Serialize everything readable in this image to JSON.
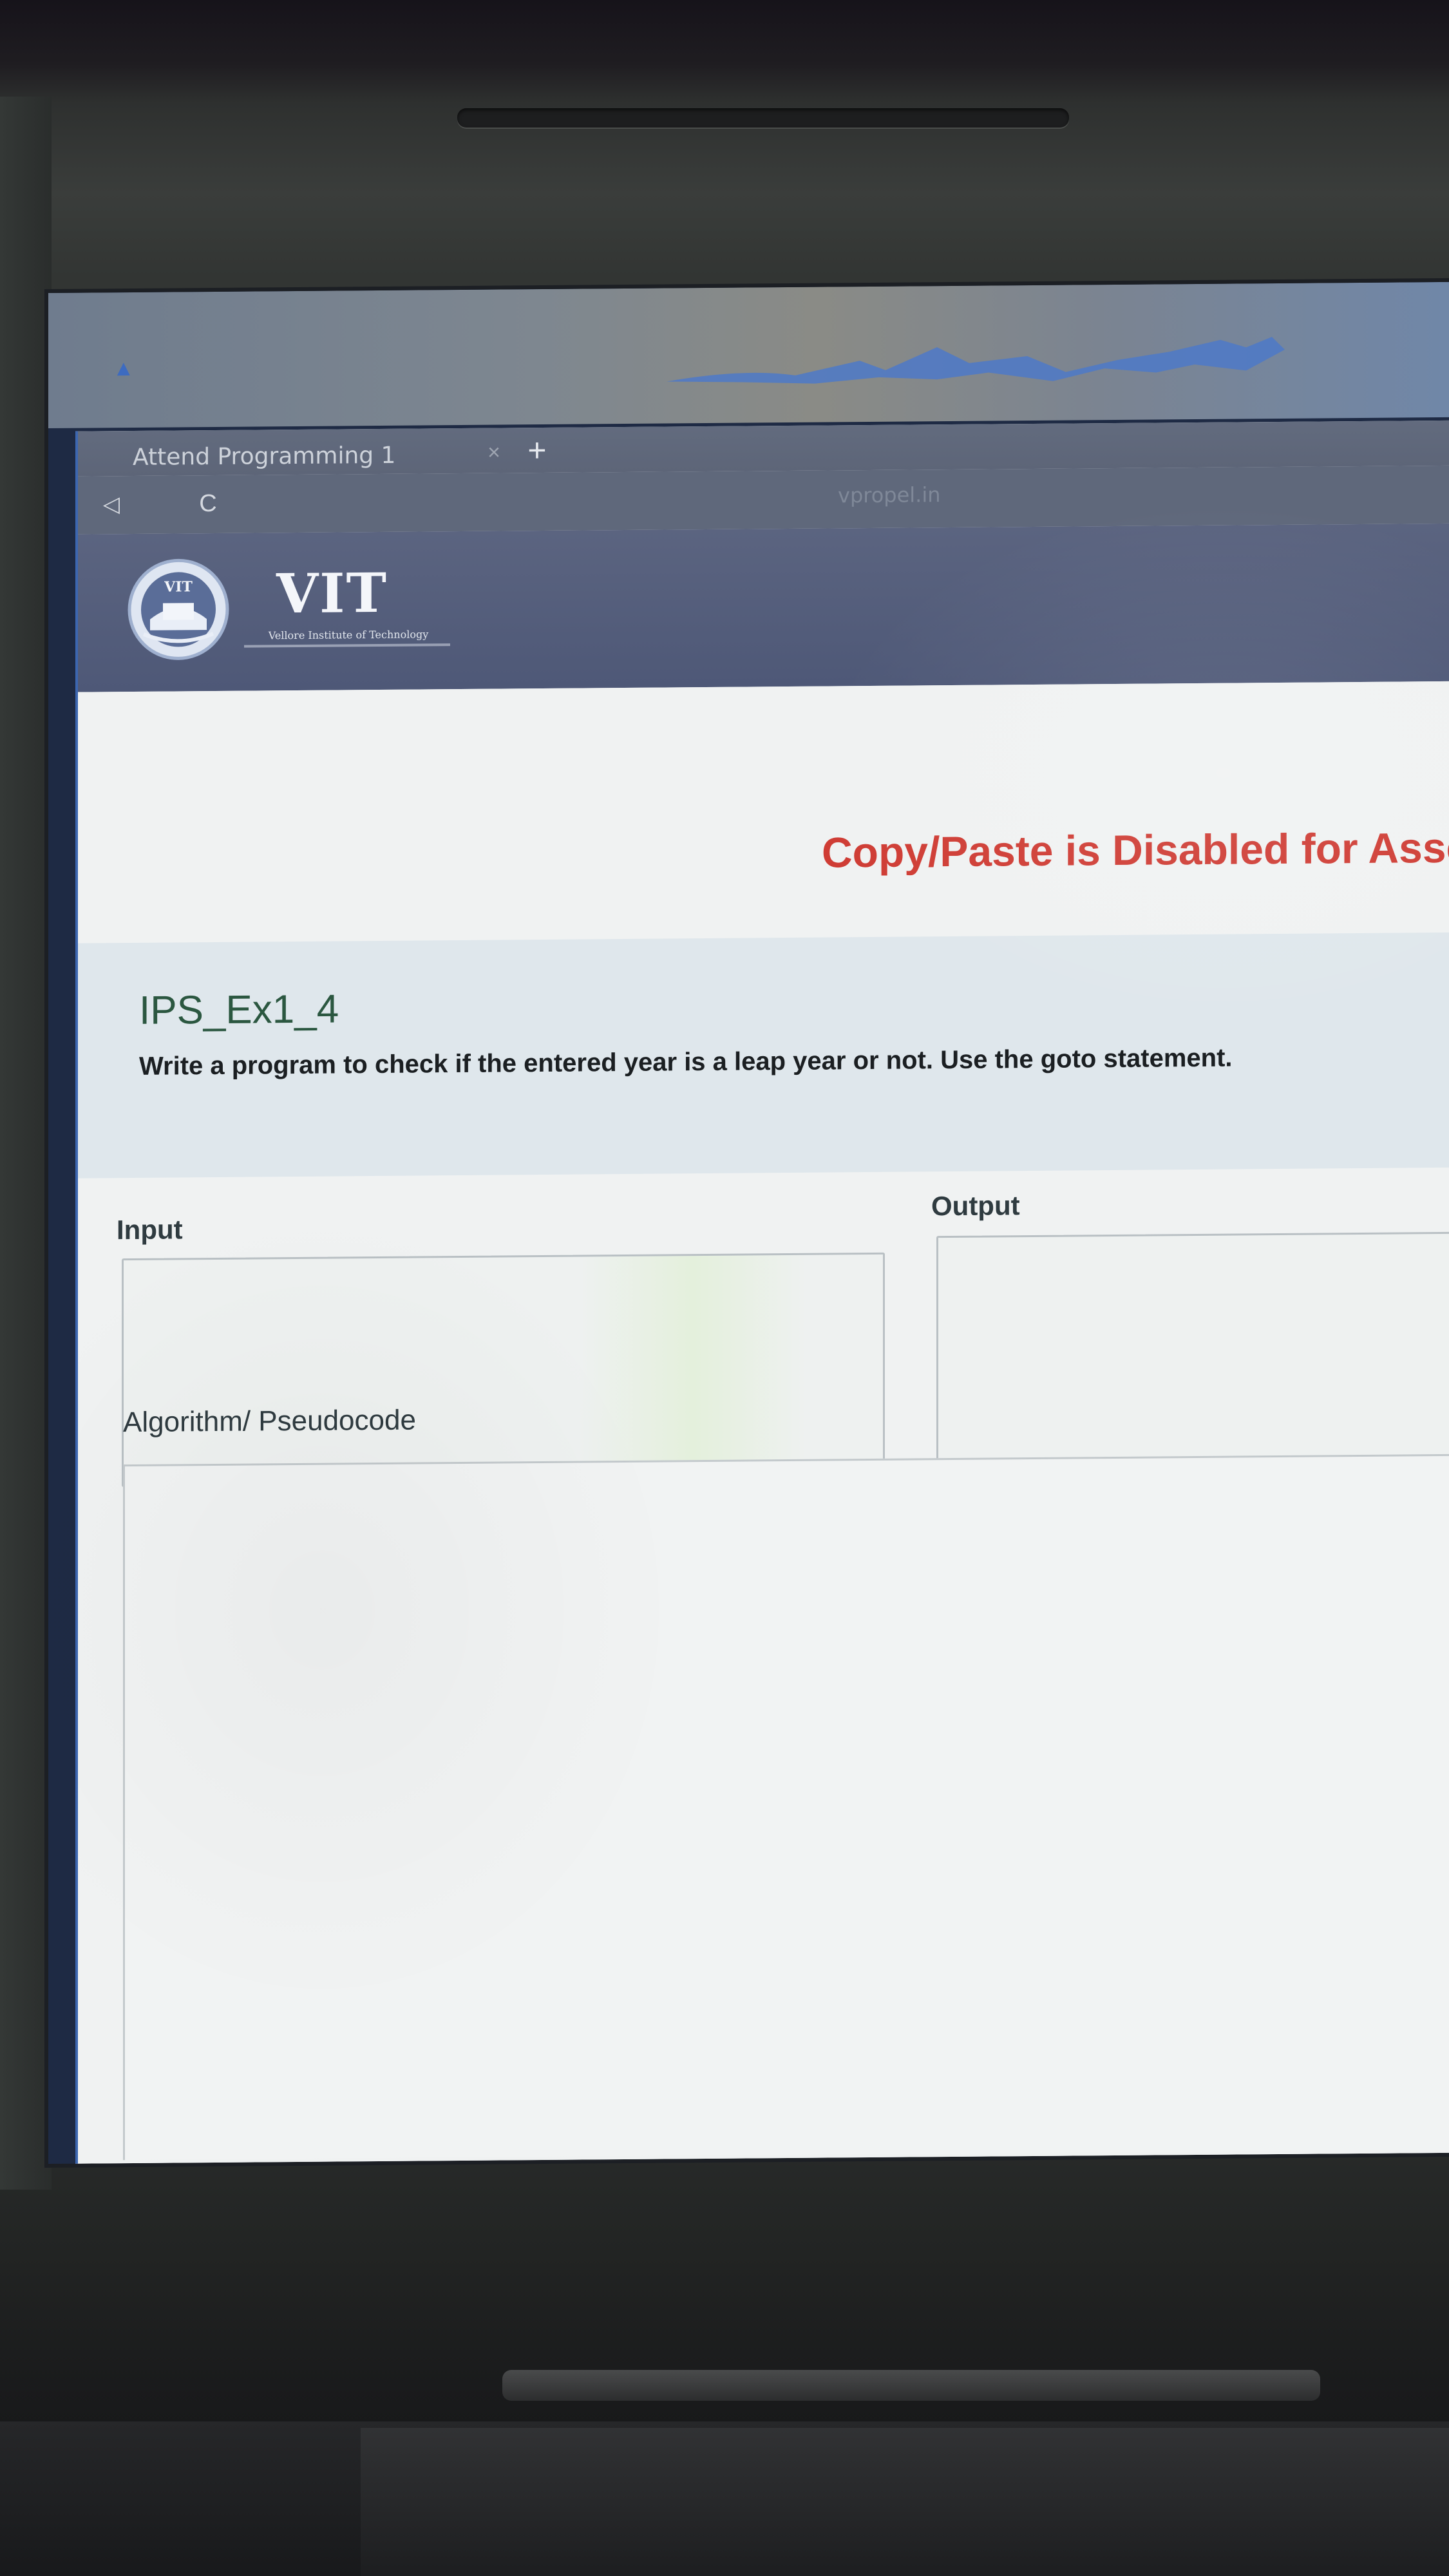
{
  "browser": {
    "tab_title": "Attend Programming 1",
    "tab_close_icon": "close-icon",
    "new_tab_icon": "plus-icon",
    "back_icon": "back-arrow-icon",
    "reload_icon": "reload-icon",
    "url": "vpropel.in"
  },
  "site_header": {
    "logo_emblem_text": "VIT",
    "logo_title": "VIT",
    "logo_subtitle": "Vellore Institute of Technology"
  },
  "page": {
    "warning_banner": "Copy/Paste is Disabled for Assess",
    "question": {
      "title": "IPS_Ex1_4",
      "text": "Write a program to check if the entered year is a leap year or not. Use the goto statement."
    },
    "input_label": "Input",
    "input_value": "",
    "output_label": "Output",
    "output_value": "",
    "algorithm_label": "Algorithm/ Pseudocode",
    "algorithm_value": ""
  },
  "colors": {
    "warning_red": "#cf3d35",
    "title_green": "#2b5740",
    "window_accent_blue": "#3c66b0",
    "header_purple": "#5b6480"
  }
}
